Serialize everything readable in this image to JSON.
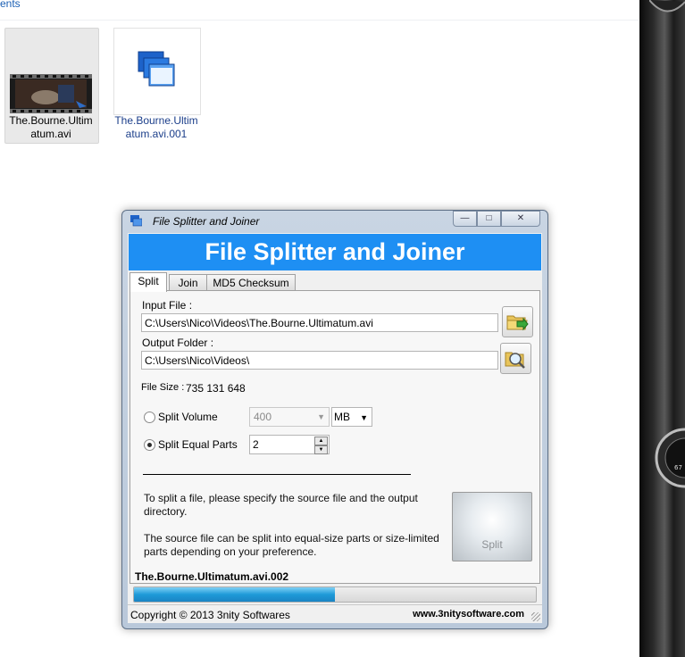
{
  "explorer": {
    "breadcrumb": "ents",
    "files": [
      {
        "name_line1": "The.Bourne.Ultim",
        "name_line2": "atum.avi",
        "icon": "video-thumbnail-icon",
        "selected": true
      },
      {
        "name_line1": "The.Bourne.Ultim",
        "name_line2": "atum.avi.001",
        "icon": "split-file-stack-icon",
        "selected": false
      }
    ]
  },
  "window": {
    "title": "File Splitter and Joiner",
    "controls": {
      "minimize": "—",
      "maximize": "□",
      "close": "✕"
    },
    "banner": "File Splitter and Joiner",
    "tabs": [
      "Split",
      "Join",
      "MD5 Checksum"
    ],
    "active_tab": "Split",
    "input_file_label": "Input File :",
    "input_file_value": "C:\\Users\\Nico\\Videos\\The.Bourne.Ultimatum.avi",
    "output_folder_label": "Output Folder :",
    "output_folder_value": "C:\\Users\\Nico\\Videos\\",
    "file_size_label": "File Size :",
    "file_size_value": "735 131 648",
    "split_volume_label": "Split Volume",
    "split_volume_value": "400",
    "split_volume_unit": "MB",
    "split_equal_label": "Split Equal Parts",
    "split_equal_value": "2",
    "selected_mode": "Split Equal Parts",
    "info_text_1a": "To split a file, please specify the source file and the output",
    "info_text_1b": "directory.",
    "info_text_2a": "The source file can be split into equal-size parts or size-limited",
    "info_text_2b": "parts depending on your preference.",
    "split_button": "Split",
    "current_file": "The.Bourne.Ultimatum.avi.002",
    "progress_percent": 50,
    "copyright": "Copyright © 2013 3nity Softwares",
    "website": "www.3nitysoftware.com"
  },
  "colors": {
    "banner_bg": "#1e8ff3",
    "progress_fill": "#1e9ad8",
    "explorer_link": "#1a5fb4"
  }
}
